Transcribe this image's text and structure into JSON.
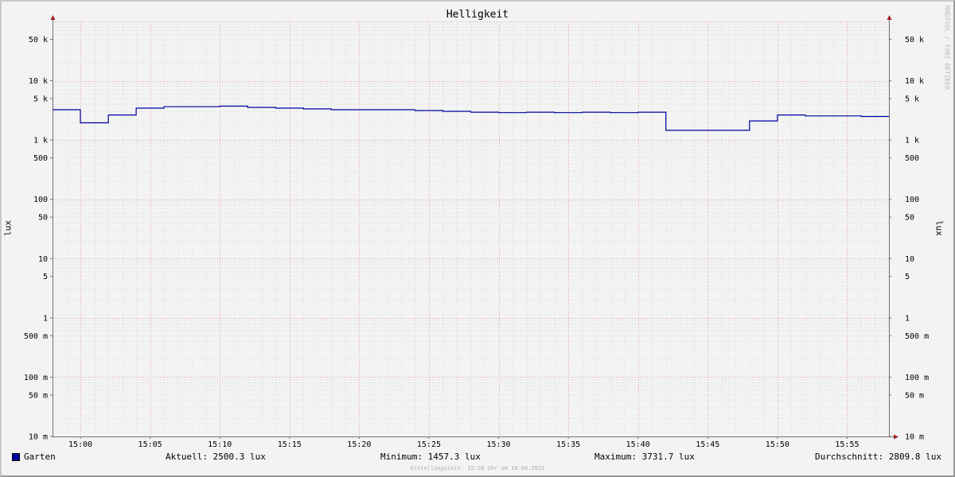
{
  "chart_data": {
    "type": "line",
    "title": "Helligkeit",
    "ylabel": "lux",
    "yscale": "log",
    "ylim": [
      0.01,
      100000
    ],
    "y_ticks": [
      {
        "value": 50000,
        "label": "50 k"
      },
      {
        "value": 10000,
        "label": "10 k"
      },
      {
        "value": 5000,
        "label": "5 k"
      },
      {
        "value": 1000,
        "label": "1 k"
      },
      {
        "value": 500,
        "label": "500"
      },
      {
        "value": 100,
        "label": "100"
      },
      {
        "value": 50,
        "label": "50"
      },
      {
        "value": 10,
        "label": "10"
      },
      {
        "value": 5,
        "label": "5"
      },
      {
        "value": 1,
        "label": "1"
      },
      {
        "value": 0.5,
        "label": "500 m"
      },
      {
        "value": 0.1,
        "label": "100 m"
      },
      {
        "value": 0.05,
        "label": "50 m"
      },
      {
        "value": 0.01,
        "label": "10 m"
      }
    ],
    "xlim": [
      "14:58",
      "15:58"
    ],
    "x_ticks": [
      "15:00",
      "15:05",
      "15:10",
      "15:15",
      "15:20",
      "15:25",
      "15:30",
      "15:35",
      "15:40",
      "15:45",
      "15:50",
      "15:55"
    ],
    "grid": true,
    "series": [
      {
        "name": "Garten",
        "color": "#0000a0",
        "step": true,
        "x": [
          "14:58",
          "15:00",
          "15:02",
          "15:04",
          "15:06",
          "15:08",
          "15:10",
          "15:12",
          "15:14",
          "15:16",
          "15:18",
          "15:20",
          "15:22",
          "15:24",
          "15:26",
          "15:28",
          "15:30",
          "15:32",
          "15:34",
          "15:36",
          "15:38",
          "15:40",
          "15:42",
          "15:44",
          "15:46",
          "15:48",
          "15:50",
          "15:52",
          "15:54",
          "15:56",
          "15:58"
        ],
        "y": [
          3250,
          1950,
          2650,
          3450,
          3650,
          3650,
          3731.7,
          3550,
          3450,
          3350,
          3250,
          3250,
          3250,
          3150,
          3050,
          2950,
          2900,
          2950,
          2900,
          2950,
          2900,
          2950,
          1457.3,
          1457.3,
          1457.3,
          2100,
          2650,
          2550,
          2550,
          2500.3,
          2500.3
        ]
      }
    ]
  },
  "legend": {
    "swatch_color": "#0000a0",
    "series_name": "Garten",
    "current": "Aktuell: 2500.3 lux",
    "minimum": "Minimum: 1457.3 lux",
    "maximum": "Maximum: 3731.7 lux",
    "average": "Durchschnitt: 2809.8 lux"
  },
  "watermark": "RRDTOOL / TOBI OETIKER",
  "footer": "Erstellungszeit: 15:58 Uhr am 10.08.2025"
}
